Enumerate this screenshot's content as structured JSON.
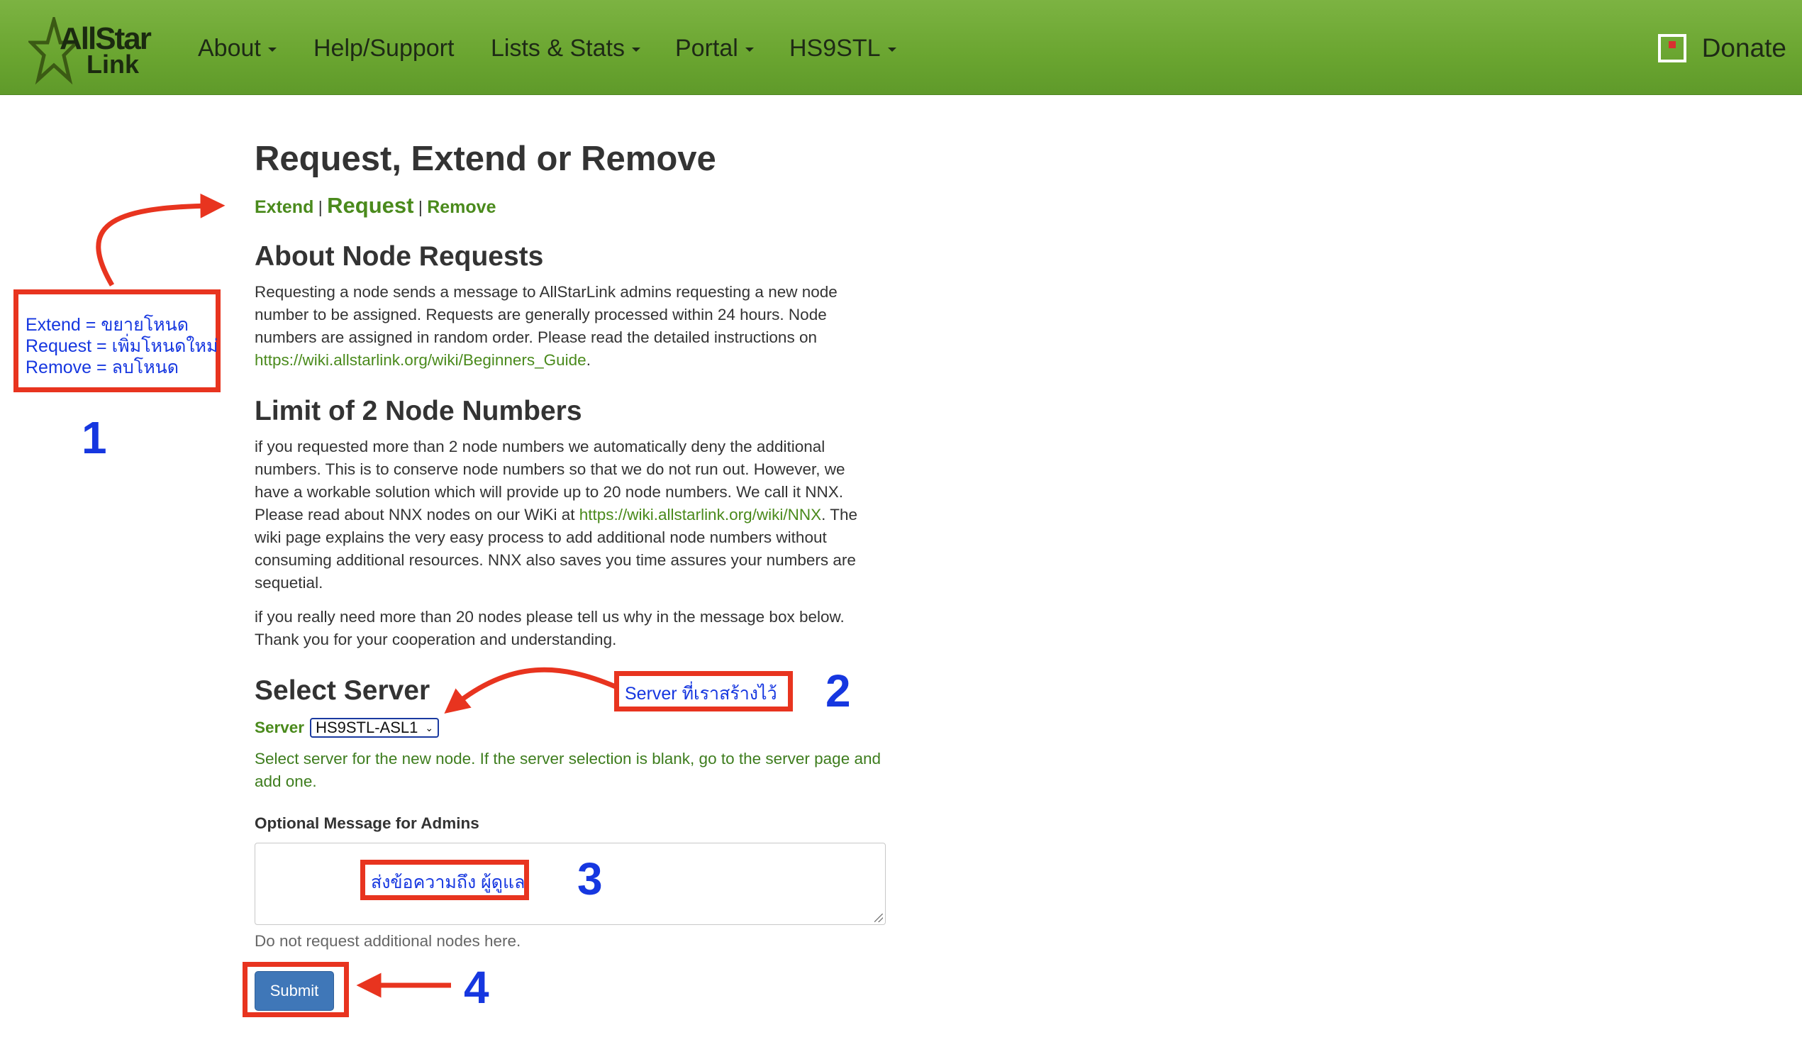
{
  "navbar": {
    "brand_line1": "AllStar",
    "brand_line2": "Link",
    "items": [
      {
        "label": "About"
      },
      {
        "label": "Help/Support"
      },
      {
        "label": "Lists & Stats"
      },
      {
        "label": "Portal"
      },
      {
        "label": "HS9STL"
      }
    ],
    "donate_label": "Donate",
    "colors": {
      "bar": "#6aa530",
      "text": "#1e2a16"
    }
  },
  "page": {
    "title": "Request, Extend or Remove",
    "subnav": {
      "extend": "Extend",
      "request": "Request",
      "remove": "Remove",
      "separator": "|"
    },
    "about": {
      "heading": "About Node Requests",
      "text": "Requesting a node sends a message to AllStarLink admins requesting a new node number to be assigned. Requests are generally processed within 24 hours. Node numbers are assigned in random order. Please read the detailed instructions on ",
      "link": "https://wiki.allstarlink.org/wiki/Beginners_Guide",
      "text_end": "."
    },
    "limit": {
      "heading": "Limit of 2 Node Numbers",
      "text1": "if you requested more than 2 node numbers we automatically deny the additional numbers. This is to conserve node numbers so that we do not run out. However, we have a workable solution which will provide up to 20 node numbers. We call it NNX. Please read about NNX nodes on our WiKi at ",
      "link": "https://wiki.allstarlink.org/wiki/NNX",
      "text1_end": ". The wiki page explains the very easy process to add additional node numbers without consuming additional resources. NNX also saves you time assures your numbers are sequetial.",
      "text2": "if you really need more than 20 nodes please tell us why in the message box below. Thank you for your cooperation and understanding."
    },
    "server": {
      "heading": "Select Server",
      "label": "Server",
      "selected": "HS9STL-ASL1",
      "help": "Select server for the new node. If the server selection is blank, go to the server page and add one."
    },
    "message": {
      "label": "Optional Message for Admins",
      "value": "",
      "help": "Do not request additional nodes here."
    },
    "submit_label": "Submit",
    "colors": {
      "link": "#4a8a1c",
      "button": "#3f77b8"
    }
  },
  "annotations": {
    "box1_lines": [
      "Extend = ขยายโหนด",
      "Request = เพิ่มโหนดใหม่",
      "Remove = ลบโหนด"
    ],
    "box2_text": "Server ที่เราสร้างไว้",
    "box3_text": "ส่งข้อความถึง ผู้ดูแล",
    "numbers": [
      "1",
      "2",
      "3",
      "4"
    ],
    "colors": {
      "box": "#e8341f",
      "text": "#1637e0"
    }
  }
}
